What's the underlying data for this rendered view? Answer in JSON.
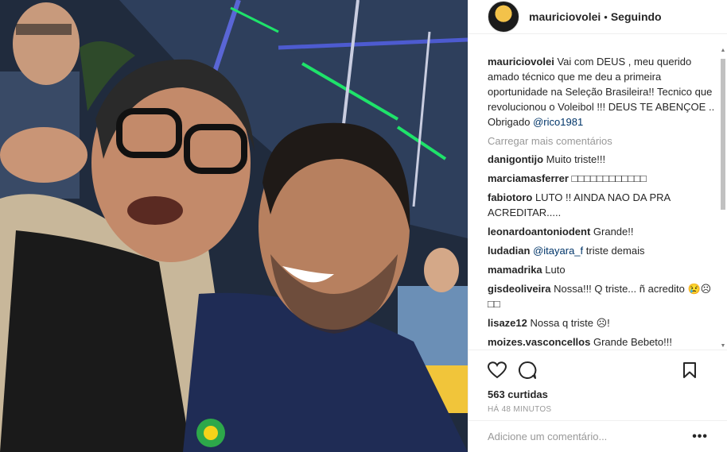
{
  "post": {
    "username": "mauriciovolei",
    "separator": "•",
    "follow_status": "Seguindo",
    "photo_alt": "Selfie de dois homens sorrindo"
  },
  "caption": {
    "username": "mauriciovolei",
    "text": "Vai com DEUS , meu querido amado técnico que me deu a primeira oportunidade na Seleção Brasileira!! Tecnico que revolucionou o Voleibol !!! DEUS TE ABENÇOE .. Obrigado",
    "mention": "@rico1981"
  },
  "load_more": "Carregar mais comentários",
  "comments": [
    {
      "user": "danigontijo",
      "text": "Muito triste!!!"
    },
    {
      "user": "marciamasferrer",
      "text": "□□□□□□□□□□□□"
    },
    {
      "user": "fabiotoro",
      "text": "LUTO !! AINDA NAO DA PRA ACREDITAR....."
    },
    {
      "user": "leonardoantoniodent",
      "text": "Grande!!"
    },
    {
      "user": "ludadian",
      "mention": "@itayara_f",
      "text": "triste demais"
    },
    {
      "user": "mamadrika",
      "text": "Luto"
    },
    {
      "user": "gisdeoliveira",
      "text": "Nossa!!! Q triste... ñ acredito 😢☹□□"
    },
    {
      "user": "lisaze12",
      "text": "Nossa q triste ☹!"
    },
    {
      "user": "moizes.vasconcellos",
      "text": "Grande Bebeto!!!"
    }
  ],
  "likes": "563 curtidas",
  "time": "HÁ 48 MINUTOS",
  "add_comment": {
    "placeholder": "Adicione um comentário..."
  },
  "more_label": "•••",
  "icons": {
    "like": "heart-icon",
    "comment": "comment-bubble-icon",
    "save": "bookmark-icon"
  }
}
